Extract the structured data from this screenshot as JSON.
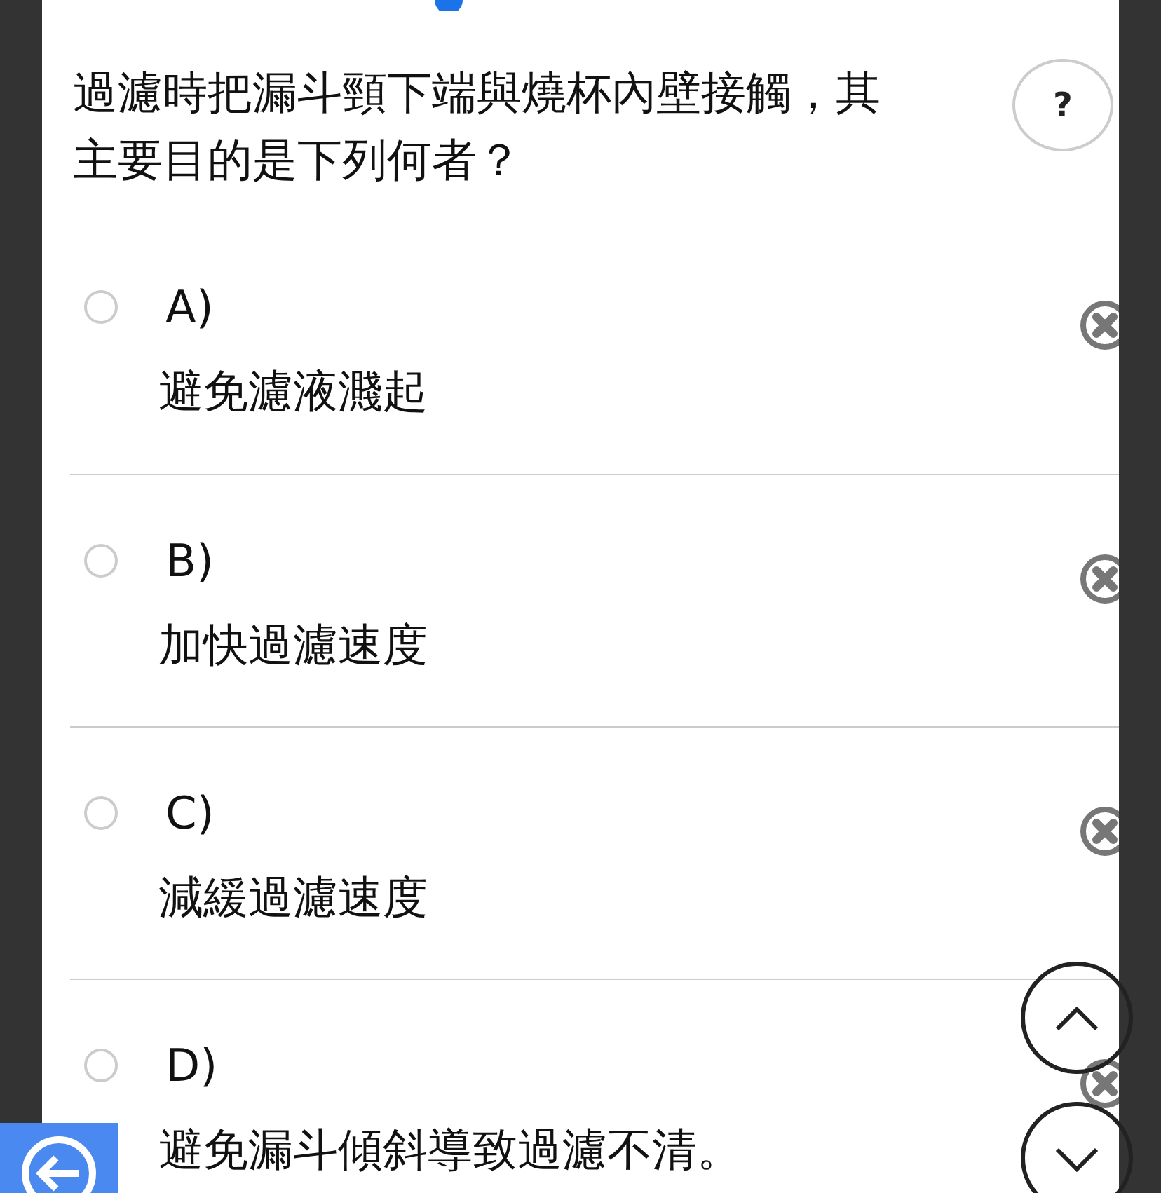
{
  "question": "過濾時把漏斗頸下端與燒杯內壁接觸，其主要目的是下列何者？",
  "help_button": "?",
  "options": [
    {
      "label": "A)",
      "text": "避免濾液濺起",
      "selected": false
    },
    {
      "label": "B)",
      "text": "加快過濾速度",
      "selected": false
    },
    {
      "label": "C)",
      "text": "減緩過濾速度",
      "selected": false
    },
    {
      "label": "D)",
      "text": "避免漏斗傾斜導致過濾不清。",
      "selected": false
    }
  ]
}
